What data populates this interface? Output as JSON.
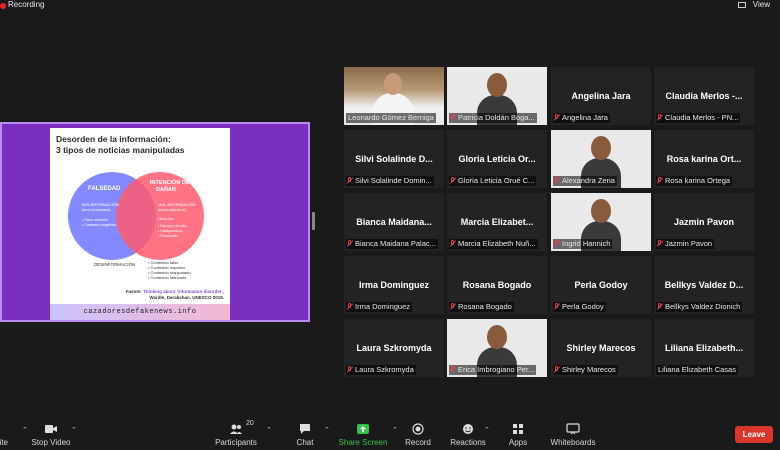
{
  "topbar": {
    "recording_label": "Recording",
    "view_label": "View"
  },
  "shared_slide": {
    "title_line1": "Desorden de la información:",
    "title_line2": "3 tipos de noticias manipuladas",
    "circle_left_title": "FALSEDAD",
    "circle_right_title_1": "INTENCIÓN DE",
    "circle_right_title_2": "DAÑAR",
    "misinfo_1": "MIS-INFORMACIÓN",
    "misinfo_2": "(error involuntario)",
    "misinfo_items": [
      "• Falsa conexión",
      "• Contenido engañoso"
    ],
    "malinfo_1": "MAL-INFORMACIÓN",
    "malinfo_2": "(busca perjudicar)",
    "malinfo_sub": "Cierta las:",
    "malinfo_items": [
      "• Discurso de odio",
      "• Hostigamiento",
      "• Filtraciones"
    ],
    "disinfo_label": "DESINFORMACIÓN",
    "disinfo_items": [
      "• Contenido falso",
      "• Contenido impostor",
      "• Contenido manipulado",
      "• Contenido fabricado"
    ],
    "source_prefix": "Fuente: ",
    "source_link": "Thinking about 'information disorder',",
    "source_rest": "Wardle, Derakshan. UNESCO 2018.",
    "url": "cazadoresdefakenews.info",
    "colors": {
      "background": "#7a2fbe",
      "left_circle": "#6f74ff",
      "right_circle": "#ff5a6e"
    }
  },
  "participants": [
    {
      "label": "Leonardo Gómez Berniga",
      "display": "",
      "muted": false,
      "video": "a",
      "active": true
    },
    {
      "label": "Patricia Doldán Boga...",
      "display": "",
      "muted": true,
      "video": "b",
      "active": false
    },
    {
      "label": "Angelina Jara",
      "display": "Angelina Jara",
      "muted": true,
      "video": "",
      "active": false
    },
    {
      "label": "Claudia Merlos - PN...",
      "display": "Claudia Merlos -...",
      "muted": true,
      "video": "",
      "active": false
    },
    {
      "label": "Silvi Solalinde Domin...",
      "display": "Silvi Solalinde D...",
      "muted": true,
      "video": "",
      "active": false
    },
    {
      "label": "Gloria Leticia Orué C...",
      "display": "Gloria Leticia Or...",
      "muted": true,
      "video": "",
      "active": false
    },
    {
      "label": "Alexandra Zena",
      "display": "",
      "muted": true,
      "video": "b",
      "active": false
    },
    {
      "label": "Rosa karina Ortega",
      "display": "Rosa karina Ort...",
      "muted": true,
      "video": "",
      "active": false
    },
    {
      "label": "Bianca Maidana Palac...",
      "display": "Bianca Maidana...",
      "muted": true,
      "video": "",
      "active": false
    },
    {
      "label": "Marcia Elizabeth Nuñ...",
      "display": "Marcia Elizabet...",
      "muted": true,
      "video": "",
      "active": false
    },
    {
      "label": "Ingrid Hannich",
      "display": "",
      "muted": true,
      "video": "b",
      "active": false
    },
    {
      "label": "Jazmin Pavon",
      "display": "Jazmin Pavon",
      "muted": true,
      "video": "",
      "active": false
    },
    {
      "label": "Irma Dominguez",
      "display": "Irma Dominguez",
      "muted": true,
      "video": "",
      "active": false
    },
    {
      "label": "Rosana Bogado",
      "display": "Rosana Bogado",
      "muted": true,
      "video": "",
      "active": false
    },
    {
      "label": "Perla Godoy",
      "display": "Perla Godoy",
      "muted": true,
      "video": "",
      "active": false
    },
    {
      "label": "Bellkys Valdez Dionich",
      "display": "Bellkys Valdez D...",
      "muted": true,
      "video": "",
      "active": false
    },
    {
      "label": "Laura Szkromyda",
      "display": "Laura Szkromyda",
      "muted": true,
      "video": "",
      "active": false
    },
    {
      "label": "Erica Imbrogiano Per...",
      "display": "",
      "muted": true,
      "video": "b",
      "active": false
    },
    {
      "label": "Shirley Marecos",
      "display": "Shirley Marecos",
      "muted": true,
      "video": "",
      "active": false
    },
    {
      "label": "Liliana Elizabeth Casas",
      "display": "Liliana Elizabeth...",
      "muted": false,
      "video": "",
      "active": false
    }
  ],
  "toolbar": {
    "mute_partial": "ite",
    "stop_video": "Stop Video",
    "participants_count": "20",
    "participants": "Participants",
    "chat": "Chat",
    "share_screen": "Share Screen",
    "record": "Record",
    "reactions": "Reactions",
    "apps": "Apps",
    "whiteboards": "Whiteboards",
    "leave": "Leave",
    "share_color": "#35c24a",
    "leave_color": "#d9352b"
  }
}
